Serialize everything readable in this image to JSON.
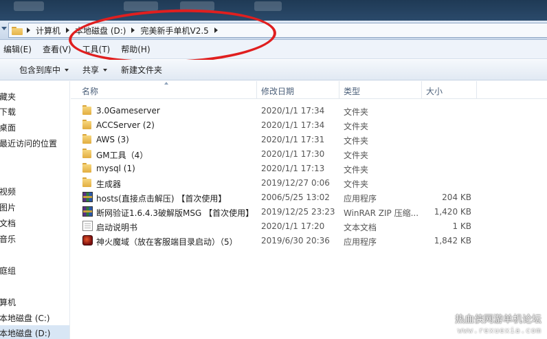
{
  "address_bar": {
    "crumbs": [
      "计算机",
      "本地磁盘 (D:)",
      "完美新手单机V2.5"
    ]
  },
  "menu": {
    "items": [
      "编辑(E)",
      "查看(V)",
      "工具(T)",
      "帮助(H)"
    ]
  },
  "toolbar": {
    "include_in_library": "包含到库中",
    "share": "共享",
    "new_folder": "新建文件夹"
  },
  "nav": {
    "items": [
      "藏夹",
      "下载",
      "桌面",
      "最近访问的位置",
      "视频",
      "图片",
      "文档",
      "音乐",
      "庭组",
      "算机",
      "本地磁盘 (C:)",
      "本地磁盘 (D:)"
    ]
  },
  "columns": {
    "name": "名称",
    "date": "修改日期",
    "type": "类型",
    "size": "大小"
  },
  "files": [
    {
      "name": "3.0Gameserver",
      "date": "2020/1/1 17:34",
      "type": "文件夹",
      "size": "",
      "icon": "folder-icon"
    },
    {
      "name": "ACCServer (2)",
      "date": "2020/1/1 17:34",
      "type": "文件夹",
      "size": "",
      "icon": "folder-icon"
    },
    {
      "name": "AWS (3)",
      "date": "2020/1/1 17:31",
      "type": "文件夹",
      "size": "",
      "icon": "folder-icon"
    },
    {
      "name": "GM工具（4）",
      "date": "2020/1/1 17:30",
      "type": "文件夹",
      "size": "",
      "icon": "folder-icon"
    },
    {
      "name": "mysql (1)",
      "date": "2020/1/1 17:13",
      "type": "文件夹",
      "size": "",
      "icon": "folder-icon"
    },
    {
      "name": "生成器",
      "date": "2019/12/27 0:06",
      "type": "文件夹",
      "size": "",
      "icon": "folder-icon"
    },
    {
      "name": "hosts(直接点击解压) 【首次使用】",
      "date": "2006/5/25 13:02",
      "type": "应用程序",
      "size": "204 KB",
      "icon": "winrar-icon"
    },
    {
      "name": "断网验证1.6.4.3破解版MSG 【首次使用】",
      "date": "2019/12/25 23:23",
      "type": "WinRAR ZIP 压缩...",
      "size": "1,420 KB",
      "icon": "winrar-icon"
    },
    {
      "name": "启动说明书",
      "date": "2020/1/1 17:20",
      "type": "文本文档",
      "size": "1 KB",
      "icon": "text-document-icon"
    },
    {
      "name": "神火魔域（放在客服端目录启动）（5）",
      "date": "2019/6/30 20:36",
      "type": "应用程序",
      "size": "1,842 KB",
      "icon": "game-app-icon"
    }
  ],
  "watermark": {
    "title": "热血侠网游单机论坛",
    "url": "www.rexuexia.com"
  },
  "colors": {
    "annotation": "#e01f1f",
    "selection": "#d8e6f5"
  }
}
